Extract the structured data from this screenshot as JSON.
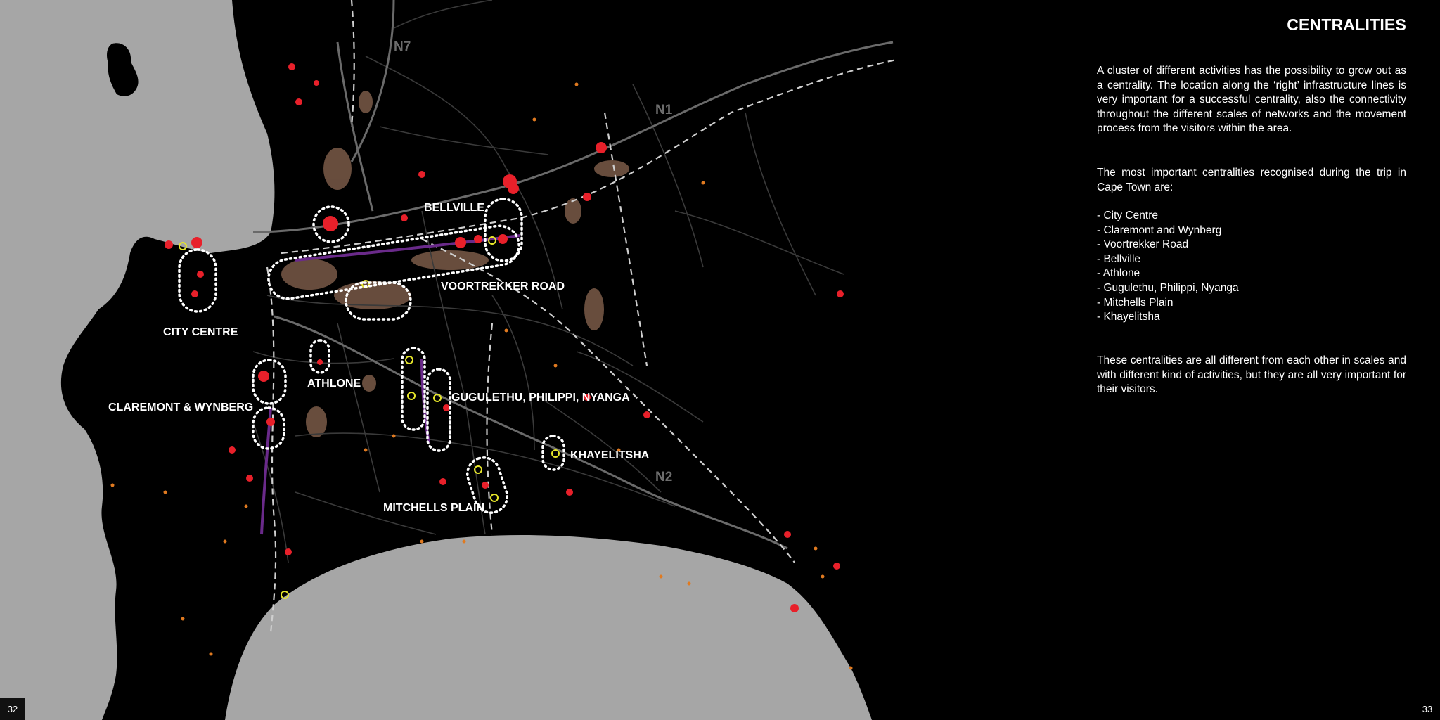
{
  "page": {
    "title": "CENTRALITIES",
    "page_left": "32",
    "page_right": "33"
  },
  "text": {
    "paragraph_1": "A cluster of different activities has the possibility to grow out as a centrality. The location along the ‘right’ infrastructure lines is very important for a successful centrality, also the connectivity throughout the different scales of networks and the movement process from the visitors within the area.",
    "paragraph_2": "The most important centralities recognised during the trip in Cape Town are:",
    "list": [
      "- City Centre",
      "- Claremont and Wynberg",
      "- Voortrekker Road",
      "- Bellville",
      "- Athlone",
      "- Gugulethu, Philippi, Nyanga",
      "- Mitchells Plain",
      "- Khayelitsha"
    ],
    "paragraph_3": "These centralities are all different from each other in scales and with different kind of activities, but they are all very important for their visitors."
  },
  "map": {
    "labels": {
      "city_centre": "CITY CENTRE",
      "bellville": "BELLVILLE",
      "voortrekker_road": "VOORTREKKER ROAD",
      "athlone": "ATHLONE",
      "claremont_wynberg": "CLAREMONT & WYNBERG",
      "gugulethu": "GUGULETHU, PHILIPPI, NYANGA",
      "khayelitsha": "KHAYELITSHA",
      "mitchells_plain": "MITCHELLS PLAIN"
    },
    "roads": {
      "n7": "N7",
      "n1": "N1",
      "n2": "N2"
    },
    "colors": {
      "sea": "#a6a6a6",
      "land": "#0a0a0a",
      "roads": "#3c3c3c",
      "highways": "#6a6a6a",
      "activity_red": "#e8202a",
      "activity_orange": "#e07a20",
      "station_yellow": "#e6e62a",
      "dense_brown": "#7a5a48",
      "purple": "#6a2a8a",
      "outline_white": "#ffffff"
    }
  }
}
